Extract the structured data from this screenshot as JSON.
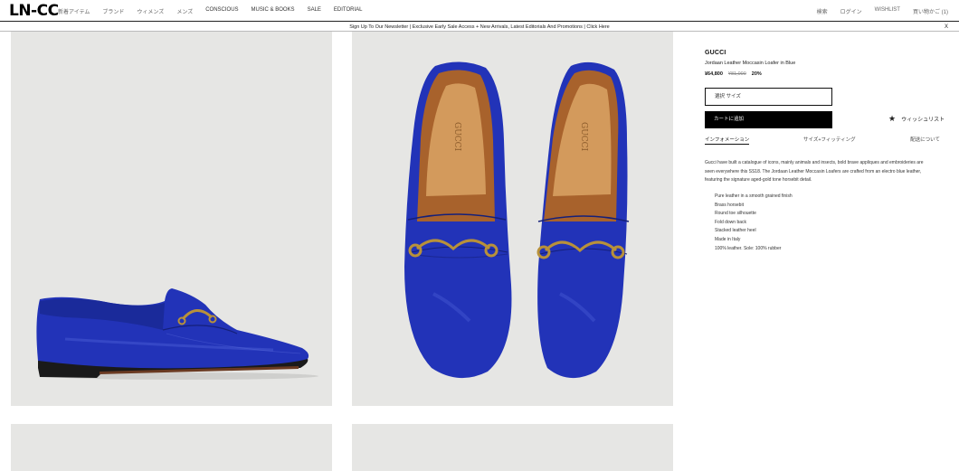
{
  "header": {
    "logo": "LN-CC",
    "nav": [
      "新着アイテム",
      "ブランド",
      "ウィメンズ",
      "メンズ",
      "CONSCIOUS",
      "MUSIC & BOOKS",
      "SALE",
      "EDITORIAL"
    ],
    "utility": [
      "検索",
      "ログイン",
      "WISHLIST",
      "買い物かご (1)"
    ]
  },
  "banner": {
    "text": "Sign Up To Our Newsletter | Exclusive Early Sale Access + New Arrivals, Latest Editorials And Promotions | Click Here",
    "close": "X"
  },
  "product": {
    "brand": "GUCCI",
    "name": "Jordaan Leather Moccasin Loafer in Blue",
    "price_now": "¥64,800",
    "price_old": "¥81,000",
    "discount": "20%",
    "size_placeholder": "選択 サイズ",
    "add_to_cart": "カートに追加",
    "wishlist": "ウィッシュリスト",
    "tabs": [
      "インフォメーション",
      "サイズ+フィッティング",
      "配送について"
    ],
    "description": "Gucci have built a catalogue of icons, mainly animals and insects, bold brave appliques and embroideries are seen everywhere this SS18. The Jordaan Leather Moccasin Loafers are crafted from an electro blue leather, featuring the signature aged-gold tone horsebit detail.",
    "features": [
      "Pure leather in a smooth grained finish",
      "Brass horsebit",
      "Round toe silhouette",
      "Fold down back",
      "Stacked leather heel",
      "Made in Italy",
      "100% leather. Sole: 100% rubber"
    ]
  },
  "images": {
    "side_view_icon": "loafer-side-image",
    "top_view_icon": "loafer-top-image"
  },
  "colors": {
    "shoe_blue": "#2233b8",
    "panel_bg": "#e6e6e4",
    "hardware_gold": "#b8913a",
    "button_black": "#000000"
  }
}
